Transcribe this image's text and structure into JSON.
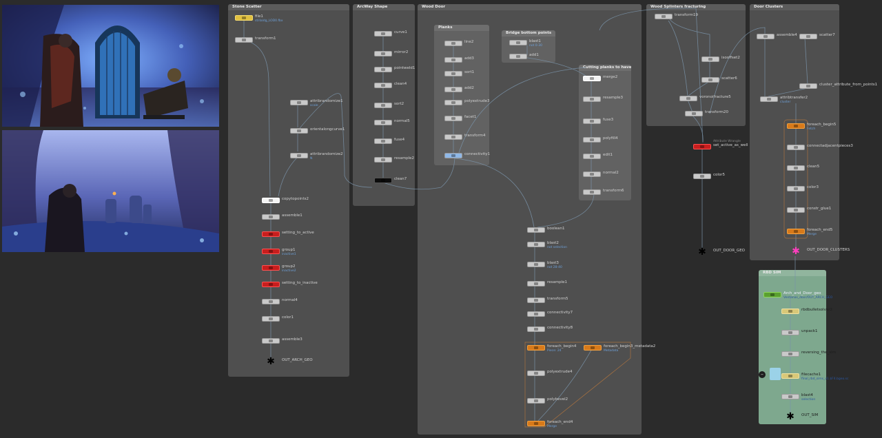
{
  "colors": {
    "background": "#2b2b2b",
    "network_box": "#4f4f4f",
    "rbd_box": "#7ea88e",
    "wire": "#7a93a9",
    "node_red": "#c81e1e",
    "node_orange": "#d87a1a",
    "output_pink": "#ff3fbf"
  },
  "reference_images": [
    {
      "label": "reference-image-arch-door"
    },
    {
      "label": "reference-image-forest-stones"
    }
  ],
  "boxes": {
    "stone_scatter": {
      "title": "Stone Scatter"
    },
    "arcway_shape": {
      "title": "ArcWay Shape"
    },
    "wood_door": {
      "title": "Wood Door"
    },
    "planks": {
      "title": "Planks"
    },
    "bridge_bottom": {
      "title": "Bridge bottom points"
    },
    "cutting_planks": {
      "title": "Cutting planks to have ..."
    },
    "wood_splinters": {
      "title": "Wood Splinters fracturing"
    },
    "door_clusters": {
      "title": "Door Clusters"
    },
    "rbd_sim": {
      "title": "RBD SIM"
    }
  },
  "nodes": {
    "file1": {
      "name": "file1",
      "sub": "stillaldg_LOD0.fbx"
    },
    "transform1": {
      "name": "transform1"
    },
    "attribrandomize1": {
      "name": "attribrandomize1",
      "sub": "scale"
    },
    "orientalongcurve1": {
      "name": "orientalongcurve1"
    },
    "attribrandomize2": {
      "name": "attribrandomize2",
      "sub": "N"
    },
    "copytopoints2": {
      "name": "copytopoints2"
    },
    "assemble1": {
      "name": "assemble1"
    },
    "setting_to_active": {
      "name": "setting_to_active"
    },
    "group1": {
      "name": "group1",
      "sub": "inactive1"
    },
    "group2": {
      "name": "group2",
      "sub": "inactive2"
    },
    "setting_to_inactive": {
      "name": "setting_to_inactive"
    },
    "normal4": {
      "name": "normal4"
    },
    "color1": {
      "name": "color1"
    },
    "assemble3": {
      "name": "assemble3"
    },
    "out_arch_geo": {
      "name": "OUT_ARCH_GEO"
    },
    "curve1": {
      "name": "curve1"
    },
    "mirror2": {
      "name": "mirror2"
    },
    "pointweld1": {
      "name": "pointweld1"
    },
    "clean4": {
      "name": "clean4"
    },
    "sort2": {
      "name": "sort2"
    },
    "normal5": {
      "name": "normal5"
    },
    "fuse4": {
      "name": "fuse4"
    },
    "resample2": {
      "name": "resample2"
    },
    "clean7": {
      "name": "clean7"
    },
    "line2": {
      "name": "line2"
    },
    "add3": {
      "name": "add3"
    },
    "sort1": {
      "name": "sort1"
    },
    "add2": {
      "name": "add2"
    },
    "polyextrude3": {
      "name": "polyextrude3"
    },
    "facet1": {
      "name": "facet1"
    },
    "transform4": {
      "name": "transform4"
    },
    "connectivity1": {
      "name": "connectivity1"
    },
    "blast1": {
      "name": "blast1",
      "sub": "not 0-30"
    },
    "add1": {
      "name": "add1"
    },
    "merge2": {
      "name": "merge2"
    },
    "resample3": {
      "name": "resample3"
    },
    "fuse3": {
      "name": "fuse3"
    },
    "polyfill4": {
      "name": "polyfill4"
    },
    "edit1": {
      "name": "edit1"
    },
    "normal2": {
      "name": "normal2"
    },
    "transform6": {
      "name": "transform6"
    },
    "boolean1": {
      "name": "boolean1"
    },
    "blast2": {
      "name": "blast2",
      "sub": "not selection"
    },
    "blast3": {
      "name": "blast3",
      "sub": "not 28-40"
    },
    "resample1": {
      "name": "resample1"
    },
    "transform5": {
      "name": "transform5"
    },
    "connectivity7": {
      "name": "connectivity7"
    },
    "connectivity8": {
      "name": "connectivity8"
    },
    "foreach_begin4": {
      "name": "foreach_begin4",
      "sub": "Piece: 24"
    },
    "foreach_begin3_metadata2": {
      "name": "foreach_begin3_metadata2",
      "sub": "Metadata"
    },
    "polyextrude4": {
      "name": "polyextrude4"
    },
    "polybevel2": {
      "name": "polybevel2"
    },
    "foreach_end4": {
      "name": "foreach_end4",
      "sub": "Merge"
    },
    "transform19": {
      "name": "transform19"
    },
    "isooffset2": {
      "name": "isooffset2"
    },
    "scatter6": {
      "name": "scatter6"
    },
    "voronoifracture5": {
      "name": "voronoifracture5"
    },
    "transform20": {
      "name": "transform20"
    },
    "set_active_as_well": {
      "name": "set_active_as_well",
      "sub": "Attribute Wrangle"
    },
    "color5": {
      "name": "color5"
    },
    "out_door_geo": {
      "name": "OUT_DOOR_GEO"
    },
    "assemble4": {
      "name": "assemble4"
    },
    "scatter7": {
      "name": "scatter7"
    },
    "cluster_attribute_from_points1": {
      "name": "cluster_attribute_from_points1"
    },
    "attribtransfer2": {
      "name": "attribtransfer2",
      "sub": "cluster"
    },
    "foreach_begin5": {
      "name": "foreach_begin5",
      "sub": "Fetch"
    },
    "connectadjacentpieces3": {
      "name": "connectadjacentpieces3"
    },
    "clean5": {
      "name": "clean5"
    },
    "color3": {
      "name": "color3"
    },
    "constr_glue1": {
      "name": "constr_glue1"
    },
    "foreach_end5": {
      "name": "foreach_end5",
      "sub": "Merge"
    },
    "out_door_clusters": {
      "name": "OUT_DOOR_CLUSTERS"
    },
    "arch_and_door_geo": {
      "name": "Arch_and_Door_geo",
      "sub": "Ventanas_door/OUT_ARCH_GEO"
    },
    "rbdbulletsolver2": {
      "name": "rbdbulletsolver2"
    },
    "unpack1": {
      "name": "unpack1"
    },
    "reversing_the_sim": {
      "name": "reversing_the_sim"
    },
    "filecache1": {
      "name": "filecache1",
      "sub": "final_rbd_sims_v1.$F4.bgeo.sc"
    },
    "blast4": {
      "name": "blast4",
      "sub": "selection"
    },
    "out_sim": {
      "name": "OUT_SIM"
    }
  }
}
